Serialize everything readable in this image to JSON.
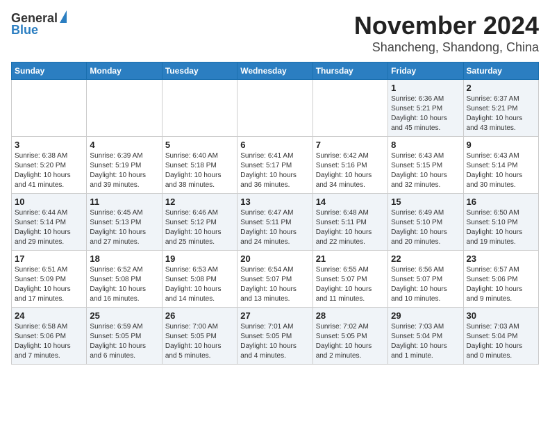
{
  "header": {
    "logo_line1": "General",
    "logo_line2": "Blue",
    "month": "November 2024",
    "location": "Shancheng, Shandong, China"
  },
  "weekdays": [
    "Sunday",
    "Monday",
    "Tuesday",
    "Wednesday",
    "Thursday",
    "Friday",
    "Saturday"
  ],
  "weeks": [
    [
      {
        "day": "",
        "info": ""
      },
      {
        "day": "",
        "info": ""
      },
      {
        "day": "",
        "info": ""
      },
      {
        "day": "",
        "info": ""
      },
      {
        "day": "",
        "info": ""
      },
      {
        "day": "1",
        "info": "Sunrise: 6:36 AM\nSunset: 5:21 PM\nDaylight: 10 hours\nand 45 minutes."
      },
      {
        "day": "2",
        "info": "Sunrise: 6:37 AM\nSunset: 5:21 PM\nDaylight: 10 hours\nand 43 minutes."
      }
    ],
    [
      {
        "day": "3",
        "info": "Sunrise: 6:38 AM\nSunset: 5:20 PM\nDaylight: 10 hours\nand 41 minutes."
      },
      {
        "day": "4",
        "info": "Sunrise: 6:39 AM\nSunset: 5:19 PM\nDaylight: 10 hours\nand 39 minutes."
      },
      {
        "day": "5",
        "info": "Sunrise: 6:40 AM\nSunset: 5:18 PM\nDaylight: 10 hours\nand 38 minutes."
      },
      {
        "day": "6",
        "info": "Sunrise: 6:41 AM\nSunset: 5:17 PM\nDaylight: 10 hours\nand 36 minutes."
      },
      {
        "day": "7",
        "info": "Sunrise: 6:42 AM\nSunset: 5:16 PM\nDaylight: 10 hours\nand 34 minutes."
      },
      {
        "day": "8",
        "info": "Sunrise: 6:43 AM\nSunset: 5:15 PM\nDaylight: 10 hours\nand 32 minutes."
      },
      {
        "day": "9",
        "info": "Sunrise: 6:43 AM\nSunset: 5:14 PM\nDaylight: 10 hours\nand 30 minutes."
      }
    ],
    [
      {
        "day": "10",
        "info": "Sunrise: 6:44 AM\nSunset: 5:14 PM\nDaylight: 10 hours\nand 29 minutes."
      },
      {
        "day": "11",
        "info": "Sunrise: 6:45 AM\nSunset: 5:13 PM\nDaylight: 10 hours\nand 27 minutes."
      },
      {
        "day": "12",
        "info": "Sunrise: 6:46 AM\nSunset: 5:12 PM\nDaylight: 10 hours\nand 25 minutes."
      },
      {
        "day": "13",
        "info": "Sunrise: 6:47 AM\nSunset: 5:11 PM\nDaylight: 10 hours\nand 24 minutes."
      },
      {
        "day": "14",
        "info": "Sunrise: 6:48 AM\nSunset: 5:11 PM\nDaylight: 10 hours\nand 22 minutes."
      },
      {
        "day": "15",
        "info": "Sunrise: 6:49 AM\nSunset: 5:10 PM\nDaylight: 10 hours\nand 20 minutes."
      },
      {
        "day": "16",
        "info": "Sunrise: 6:50 AM\nSunset: 5:10 PM\nDaylight: 10 hours\nand 19 minutes."
      }
    ],
    [
      {
        "day": "17",
        "info": "Sunrise: 6:51 AM\nSunset: 5:09 PM\nDaylight: 10 hours\nand 17 minutes."
      },
      {
        "day": "18",
        "info": "Sunrise: 6:52 AM\nSunset: 5:08 PM\nDaylight: 10 hours\nand 16 minutes."
      },
      {
        "day": "19",
        "info": "Sunrise: 6:53 AM\nSunset: 5:08 PM\nDaylight: 10 hours\nand 14 minutes."
      },
      {
        "day": "20",
        "info": "Sunrise: 6:54 AM\nSunset: 5:07 PM\nDaylight: 10 hours\nand 13 minutes."
      },
      {
        "day": "21",
        "info": "Sunrise: 6:55 AM\nSunset: 5:07 PM\nDaylight: 10 hours\nand 11 minutes."
      },
      {
        "day": "22",
        "info": "Sunrise: 6:56 AM\nSunset: 5:07 PM\nDaylight: 10 hours\nand 10 minutes."
      },
      {
        "day": "23",
        "info": "Sunrise: 6:57 AM\nSunset: 5:06 PM\nDaylight: 10 hours\nand 9 minutes."
      }
    ],
    [
      {
        "day": "24",
        "info": "Sunrise: 6:58 AM\nSunset: 5:06 PM\nDaylight: 10 hours\nand 7 minutes."
      },
      {
        "day": "25",
        "info": "Sunrise: 6:59 AM\nSunset: 5:05 PM\nDaylight: 10 hours\nand 6 minutes."
      },
      {
        "day": "26",
        "info": "Sunrise: 7:00 AM\nSunset: 5:05 PM\nDaylight: 10 hours\nand 5 minutes."
      },
      {
        "day": "27",
        "info": "Sunrise: 7:01 AM\nSunset: 5:05 PM\nDaylight: 10 hours\nand 4 minutes."
      },
      {
        "day": "28",
        "info": "Sunrise: 7:02 AM\nSunset: 5:05 PM\nDaylight: 10 hours\nand 2 minutes."
      },
      {
        "day": "29",
        "info": "Sunrise: 7:03 AM\nSunset: 5:04 PM\nDaylight: 10 hours\nand 1 minute."
      },
      {
        "day": "30",
        "info": "Sunrise: 7:03 AM\nSunset: 5:04 PM\nDaylight: 10 hours\nand 0 minutes."
      }
    ]
  ]
}
